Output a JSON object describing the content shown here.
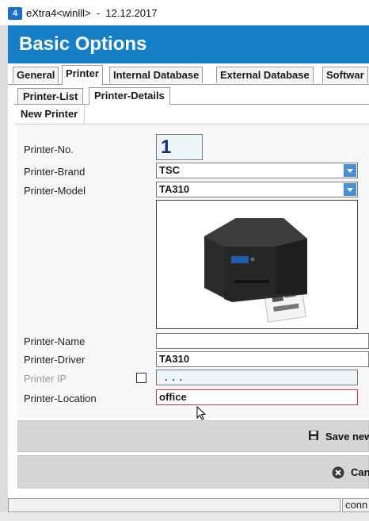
{
  "window": {
    "app_icon_label": "4",
    "title": "eXtra4<winlll>  -  12.12.2017"
  },
  "header": {
    "title": "Basic Options"
  },
  "main_tabs": [
    {
      "label": "General"
    },
    {
      "label": "Printer"
    },
    {
      "label": "Internal Database"
    },
    {
      "label": "External Database"
    },
    {
      "label": "Softwar"
    }
  ],
  "sub_tabs": [
    {
      "label": "Printer-List"
    },
    {
      "label": "Printer-Details"
    }
  ],
  "section": {
    "label": "New Printer"
  },
  "form": {
    "printer_no": {
      "label": "Printer-No.",
      "value": "1"
    },
    "brand": {
      "label": "Printer-Brand",
      "value": "TSC"
    },
    "model": {
      "label": "Printer-Model",
      "value": "TA310"
    },
    "name": {
      "label": "Printer-Name",
      "value": ""
    },
    "driver": {
      "label": "Printer-Driver",
      "value": "TA310"
    },
    "ip": {
      "label": "Printer IP",
      "value": ".  .  ."
    },
    "location": {
      "label": "Printer-Location",
      "value": "office"
    }
  },
  "buttons": {
    "save": "Save new",
    "cancel": "Canc"
  },
  "status": {
    "right_text": "conn"
  },
  "colors": {
    "header_blue": "#1580c8",
    "dropdown_blue": "#4a8ed8",
    "location_border": "#d9363e"
  }
}
